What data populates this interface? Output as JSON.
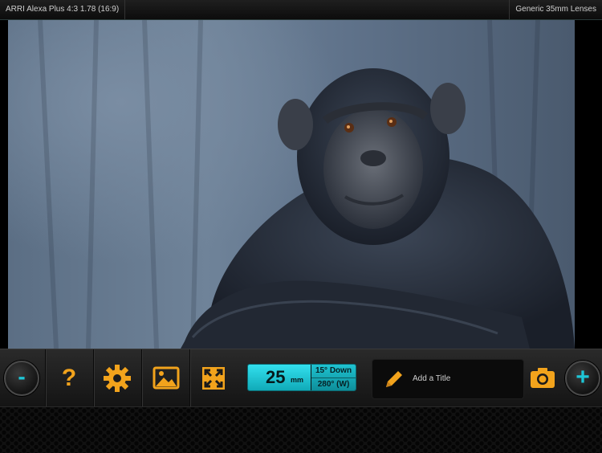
{
  "header": {
    "camera_format": "ARRI Alexa Plus 4:3 1.78 (16:9)",
    "lens_set": "Generic 35mm Lenses"
  },
  "toolbar": {
    "zoom_out_symbol": "-",
    "zoom_in_symbol": "+",
    "help_symbol": "?",
    "focal_length": "25",
    "focal_unit": "mm",
    "tilt_angle": "15° Down",
    "heading_angle": "280° (W)",
    "title_placeholder": "Add a Title"
  },
  "colors": {
    "accent_orange": "#f2a31c",
    "accent_cyan": "#1ec6d6"
  },
  "icons": [
    "minus-icon",
    "help-icon",
    "gear-icon",
    "image-icon",
    "expand-icon",
    "pencil-icon",
    "camera-icon",
    "plus-icon"
  ]
}
